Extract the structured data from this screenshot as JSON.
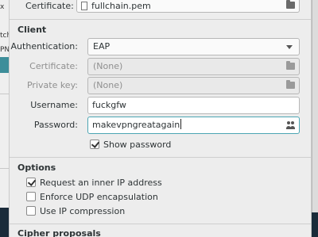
{
  "background": {
    "left_fragments": [
      "x",
      "tch",
      "PN"
    ]
  },
  "top": {
    "certificate_label": "Certificate:",
    "certificate_file": "fullchain.pem"
  },
  "client": {
    "title": "Client",
    "authentication_label": "Authentication:",
    "authentication_value": "EAP",
    "certificate_label": "Certificate:",
    "certificate_value": "(None)",
    "private_key_label": "Private key:",
    "private_key_value": "(None)",
    "username_label": "Username:",
    "username_value": "fuckgfw",
    "password_label": "Password:",
    "password_value": "makevpngreatagain",
    "show_password_label": "Show password",
    "show_password_checked": true
  },
  "options": {
    "title": "Options",
    "items": [
      {
        "label": "Request an inner IP address",
        "checked": true
      },
      {
        "label": "Enforce UDP encapsulation",
        "checked": false
      },
      {
        "label": "Use IP compression",
        "checked": false
      }
    ]
  },
  "cipher": {
    "title": "Cipher proposals"
  },
  "colors": {
    "focus_border": "#4ca5b3",
    "desktop": "#2a5f78"
  }
}
